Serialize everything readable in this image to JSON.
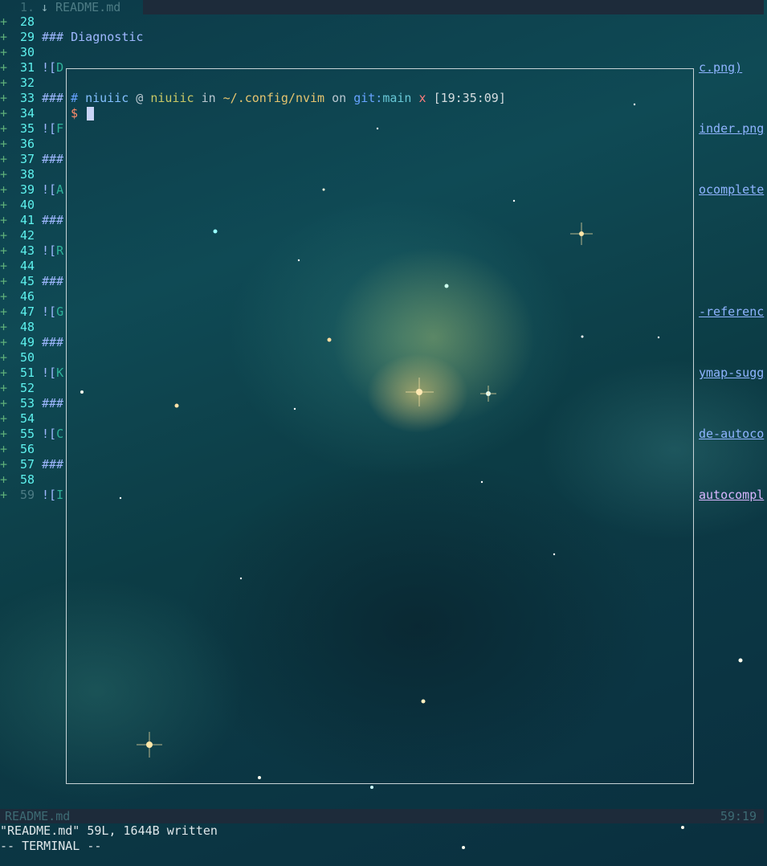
{
  "tabline": {
    "tab_number": "1.",
    "tab_icon": "↓",
    "tab_name": "README.md"
  },
  "editor": {
    "lines": [
      {
        "num": "28",
        "left": "",
        "right": ""
      },
      {
        "num": "29",
        "left": "### Diagnostic",
        "right": ""
      },
      {
        "num": "30",
        "left": "",
        "right": ""
      },
      {
        "num": "31",
        "left": "![D",
        "right": "c.png)"
      },
      {
        "num": "32",
        "left": "",
        "right": ""
      },
      {
        "num": "33",
        "left": "###",
        "right": ""
      },
      {
        "num": "34",
        "left": "",
        "right": ""
      },
      {
        "num": "35",
        "left": "![F",
        "right": "inder.png"
      },
      {
        "num": "36",
        "left": "",
        "right": ""
      },
      {
        "num": "37",
        "left": "###",
        "right": ""
      },
      {
        "num": "38",
        "left": "",
        "right": ""
      },
      {
        "num": "39",
        "left": "![A",
        "right": "ocomplete"
      },
      {
        "num": "40",
        "left": "",
        "right": ""
      },
      {
        "num": "41",
        "left": "###",
        "right": ""
      },
      {
        "num": "42",
        "left": "",
        "right": ""
      },
      {
        "num": "43",
        "left": "![R",
        "right": ""
      },
      {
        "num": "44",
        "left": "",
        "right": ""
      },
      {
        "num": "45",
        "left": "###",
        "right": ""
      },
      {
        "num": "46",
        "left": "",
        "right": ""
      },
      {
        "num": "47",
        "left": "![G",
        "right": "-referenc"
      },
      {
        "num": "48",
        "left": "",
        "right": ""
      },
      {
        "num": "49",
        "left": "###",
        "right": ""
      },
      {
        "num": "50",
        "left": "",
        "right": ""
      },
      {
        "num": "51",
        "left": "![K",
        "right": "ymap-sugg"
      },
      {
        "num": "52",
        "left": "",
        "right": ""
      },
      {
        "num": "53",
        "left": "###",
        "right": ""
      },
      {
        "num": "54",
        "left": "",
        "right": ""
      },
      {
        "num": "55",
        "left": "![C",
        "right": "de-autoco"
      },
      {
        "num": "56",
        "left": "",
        "right": ""
      },
      {
        "num": "57",
        "left": "###",
        "right": ""
      },
      {
        "num": "58",
        "left": "",
        "right": ""
      },
      {
        "num": "59",
        "left": "![I",
        "right": "autocompl"
      }
    ]
  },
  "terminal": {
    "prompt": {
      "hash": "#",
      "user": "niuiic",
      "at": "@",
      "host": "niuiic",
      "in": "in",
      "path": "~/.config/nvim",
      "on": "on",
      "git": "git:",
      "branch": "main",
      "dirty": "x",
      "time": "[19:35:09]"
    },
    "input_prompt": "$"
  },
  "statusline": {
    "file": "README.md",
    "position": "59:19"
  },
  "cmdline": {
    "message": "\"README.md\" 59L, 1644B written",
    "mode": "-- TERMINAL --"
  }
}
